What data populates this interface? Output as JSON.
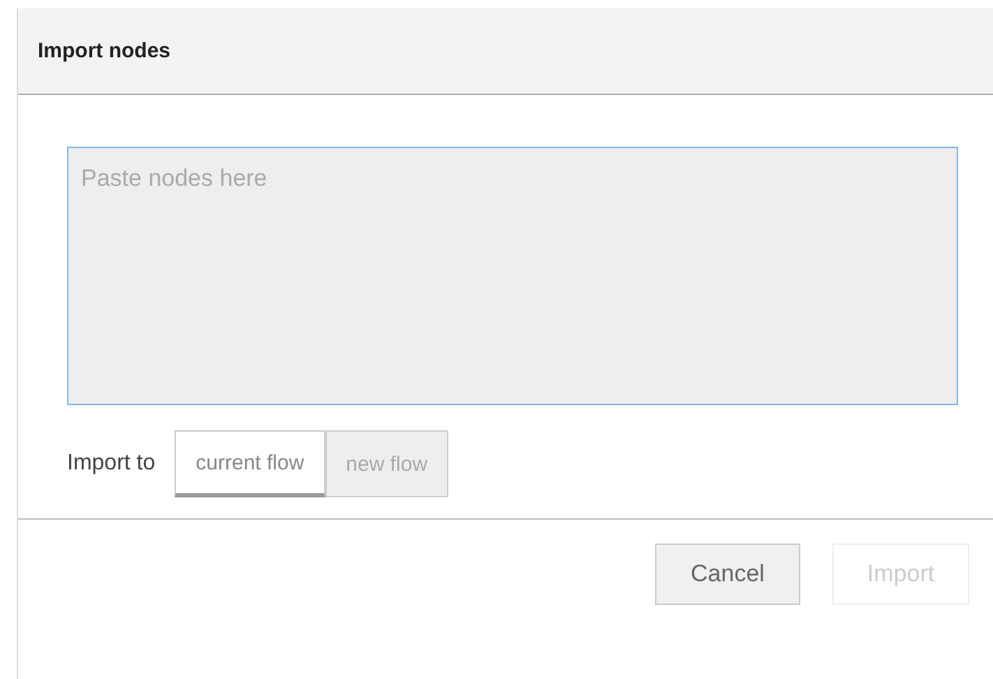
{
  "dialog": {
    "title": "Import nodes",
    "textarea": {
      "placeholder": "Paste nodes here",
      "focused": true
    },
    "import_to": {
      "label": "Import to",
      "options": [
        {
          "label": "current flow",
          "selected": true
        },
        {
          "label": "new flow",
          "selected": false
        }
      ]
    },
    "buttons": [
      {
        "label": "Cancel",
        "disabled": false
      },
      {
        "label": "Import",
        "disabled": true
      }
    ]
  }
}
